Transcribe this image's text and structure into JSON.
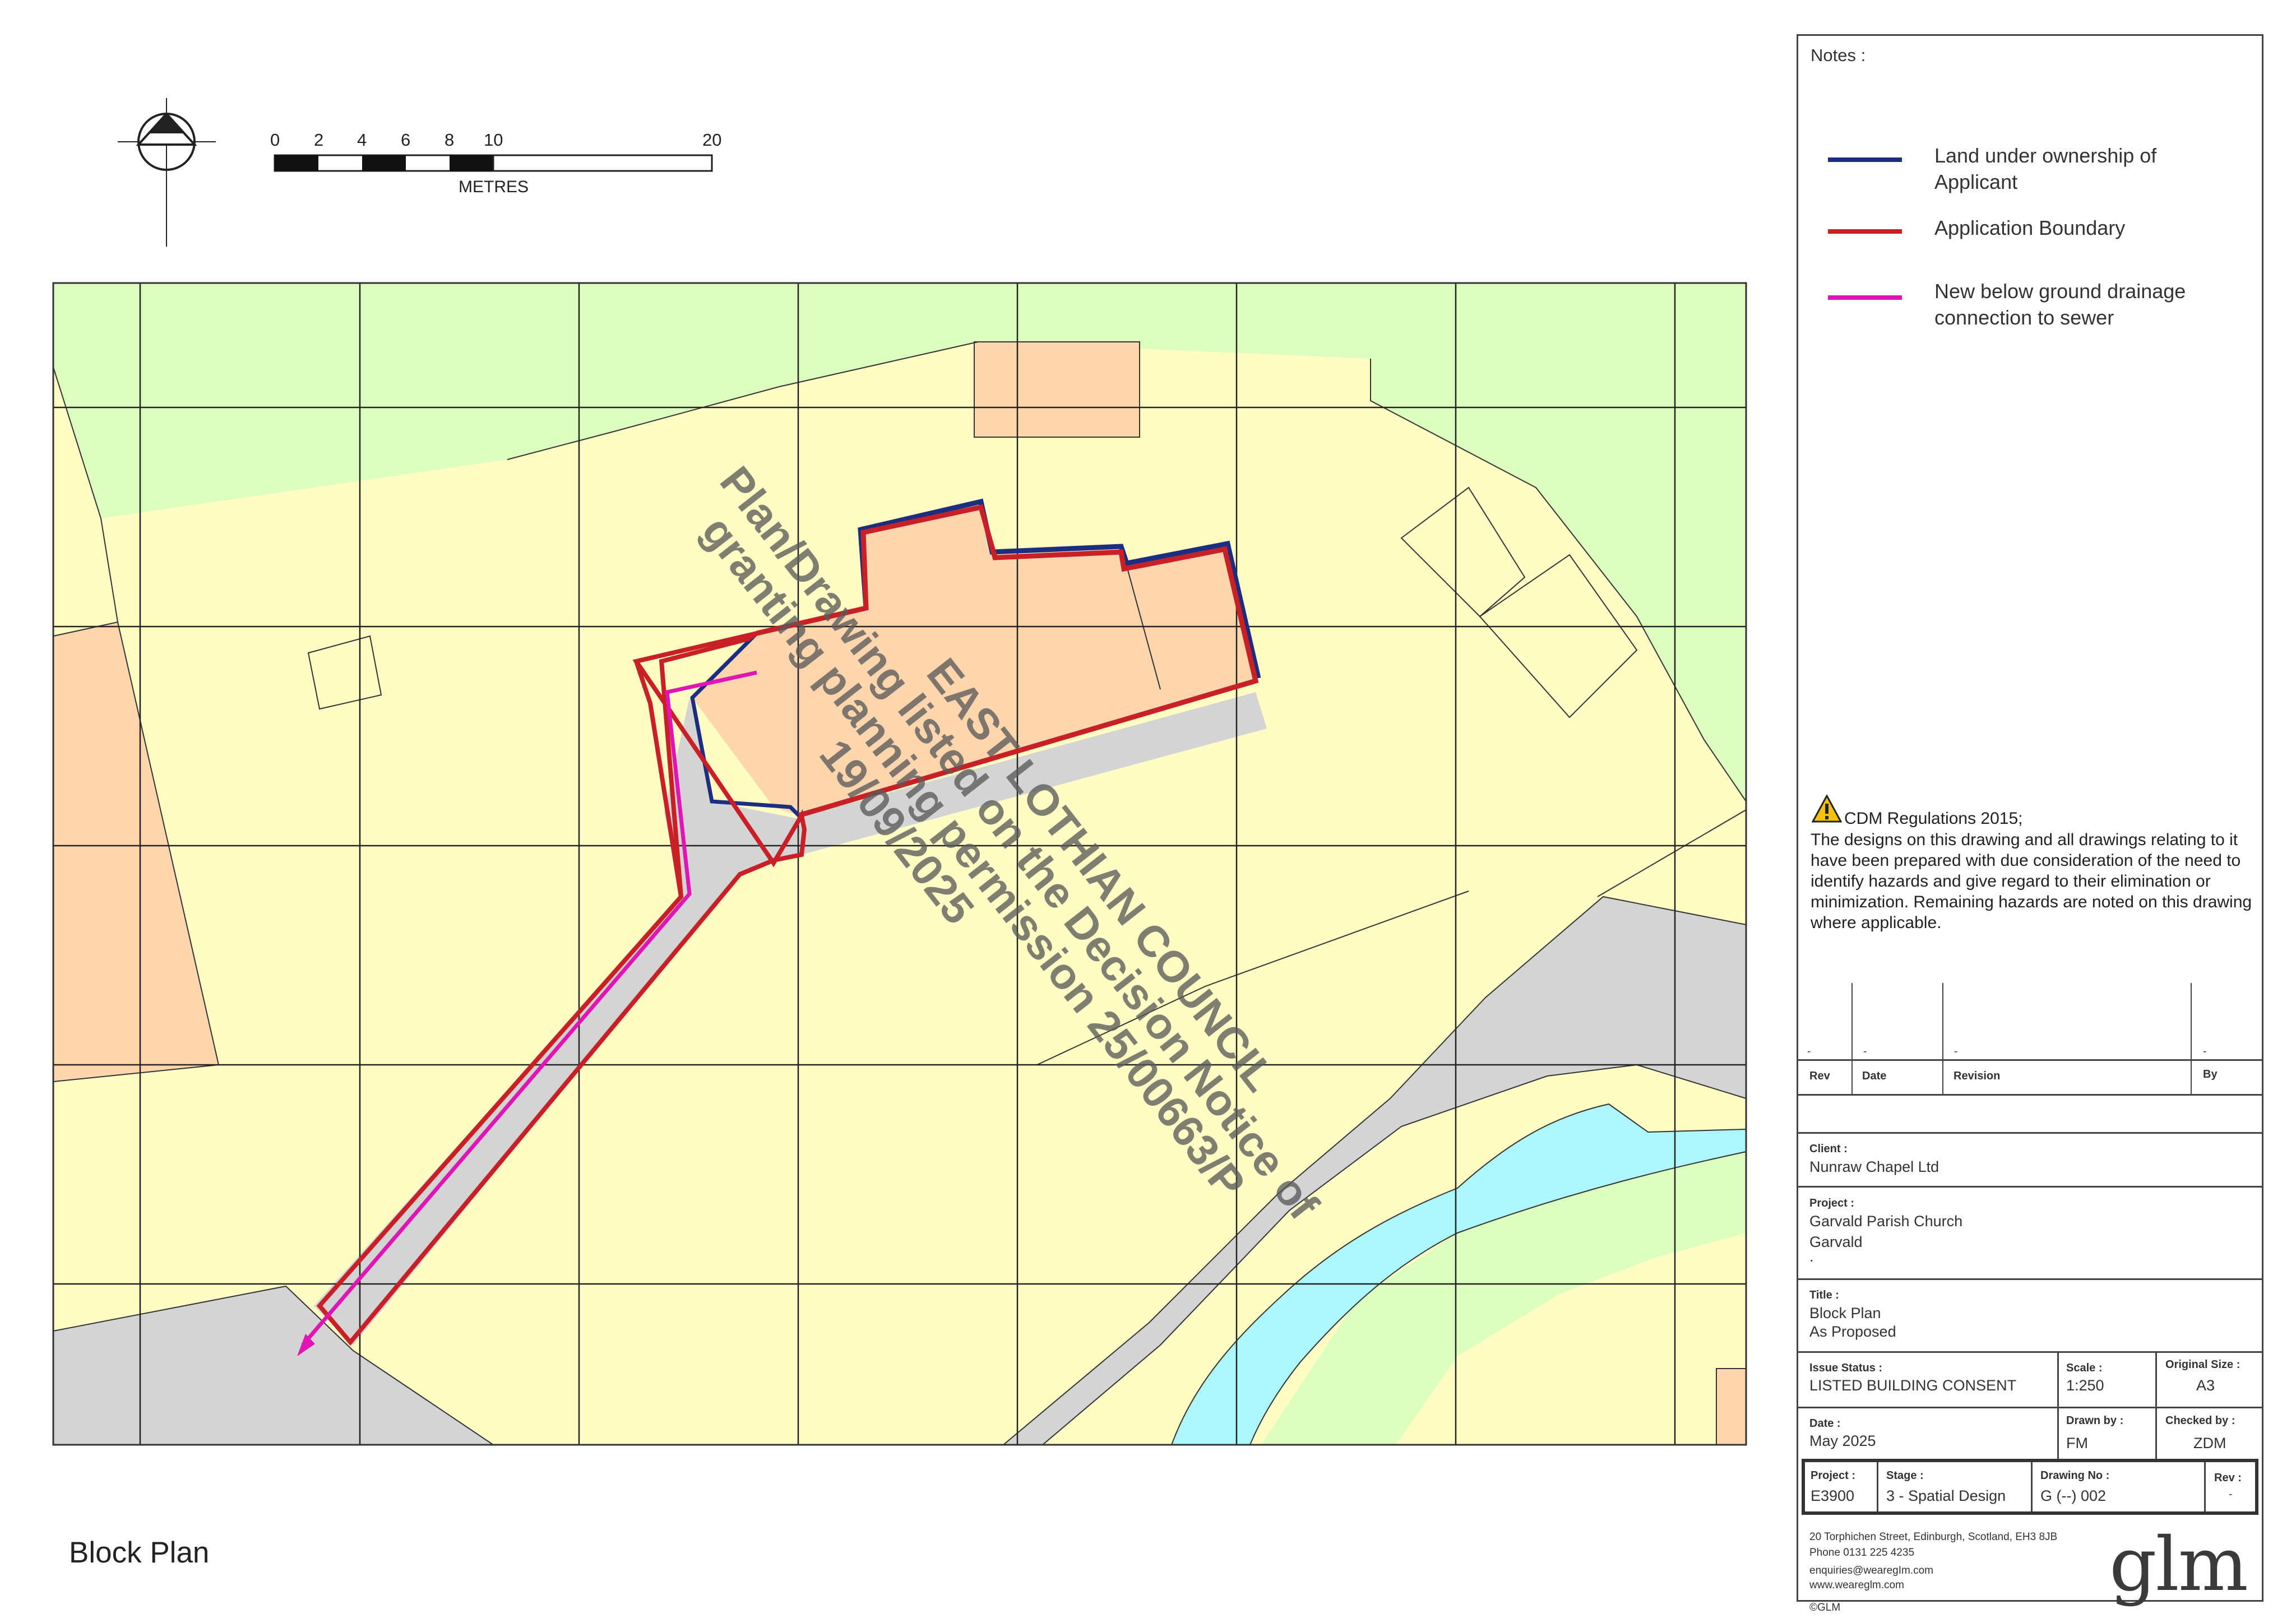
{
  "scale_bar": {
    "ticks": [
      "0",
      "2",
      "4",
      "6",
      "8",
      "10",
      "20"
    ],
    "unit_label": "METRES"
  },
  "watermark": {
    "line1": "EAST LOTHIAN COUNCIL",
    "line2": "Plan/Drawing listed on the Decision Notice of",
    "line3": "granting planning permission 25/00663/P",
    "line4": "19/09/2025"
  },
  "drawing_label": "Block Plan",
  "colors": {
    "grass": "#dcffbf",
    "land": "#fffcc4",
    "building": "#fdd6ad",
    "road": "#d4d4d4",
    "water": "#acf6fc",
    "ownership_line": "#1c2e80",
    "boundary_line": "#c92027",
    "drainage_line": "#e015b4"
  },
  "notes": {
    "heading": "Notes :",
    "legend": [
      {
        "key": "ownership",
        "text": "Land under ownership of Applicant"
      },
      {
        "key": "boundary",
        "text": "Application Boundary"
      },
      {
        "key": "drainage",
        "text": "New below ground drainage connection to sewer"
      }
    ],
    "cdm_title": "CDM Regulations 2015;",
    "cdm_body": "The designs on this drawing and all drawings relating to it have been prepared with due consideration of the need to identify hazards and give regard to their elimination or minimization. Remaining hazards are noted on this drawing where applicable."
  },
  "revision_table": {
    "row": {
      "rev": "-",
      "date": "-",
      "revision": "-",
      "by": "-"
    },
    "headers": {
      "rev": "Rev",
      "date": "Date",
      "revision": "Revision",
      "by": "By"
    }
  },
  "title_block": {
    "client_label": "Client :",
    "client": "Nunraw Chapel Ltd",
    "project_label": "Project :",
    "project_line1": "Garvald Parish Church",
    "project_line2": "Garvald",
    "project_line3": ".",
    "title_label": "Title :",
    "title_line1": "Block Plan",
    "title_line2": "As Proposed",
    "issue_status_label": "Issue Status :",
    "issue_status": "LISTED BUILDING CONSENT",
    "scale_label": "Scale :",
    "scale": "1:250",
    "original_size_label": "Original Size :",
    "original_size": "A3",
    "date_label": "Date :",
    "date": "May 2025",
    "drawn_by_label": "Drawn by :",
    "drawn_by": "FM",
    "checked_by_label": "Checked by :",
    "checked_by": "ZDM",
    "project_no_label": "Project :",
    "project_no": "E3900",
    "stage_label": "Stage :",
    "stage": "3 - Spatial Design",
    "drawing_no_label": "Drawing No :",
    "drawing_no": "G (--)  002",
    "rev_label": "Rev :",
    "rev": "-"
  },
  "company": {
    "address": "20 Torphichen Street, Edinburgh, Scotland, EH3 8JB",
    "phone": "Phone 0131 225 4235",
    "email": "enquiries@wearegIm.com",
    "web": "www.weareglm.com",
    "copyright": "©GLM",
    "logo": "glm"
  }
}
